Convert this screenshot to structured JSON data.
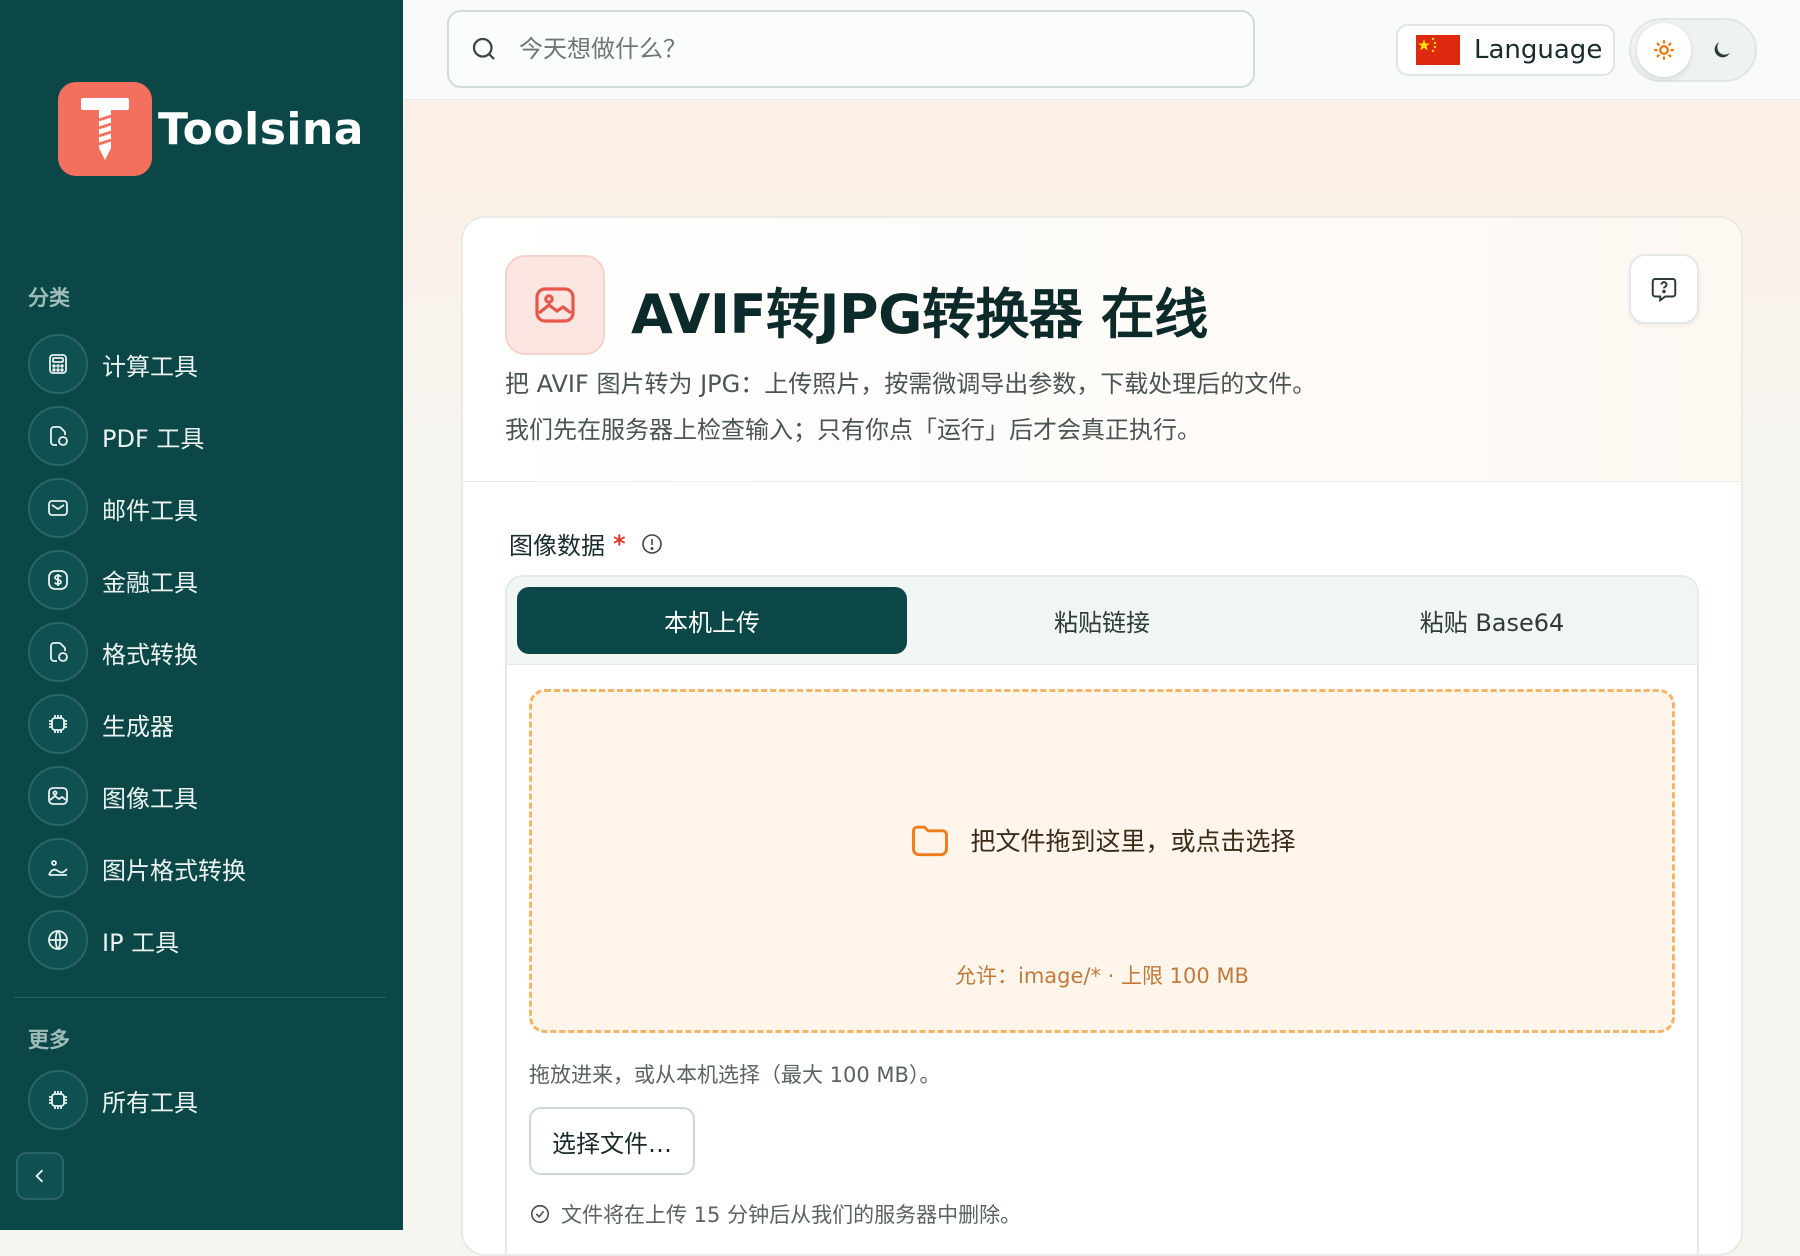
{
  "sidebar": {
    "brand": "Toolsina",
    "category_label": "分类",
    "items": [
      {
        "label": "计算工具",
        "icon": "calculator-icon"
      },
      {
        "label": "PDF 工具",
        "icon": "file-icon"
      },
      {
        "label": "邮件工具",
        "icon": "mail-icon"
      },
      {
        "label": "金融工具",
        "icon": "dollar-icon"
      },
      {
        "label": "格式转换",
        "icon": "file-convert-icon"
      },
      {
        "label": "生成器",
        "icon": "chip-icon"
      },
      {
        "label": "图像工具",
        "icon": "image-icon"
      },
      {
        "label": "图片格式转换",
        "icon": "image-convert-icon"
      },
      {
        "label": "IP 工具",
        "icon": "globe-icon"
      }
    ],
    "more_label": "更多",
    "more_items": [
      {
        "label": "所有工具",
        "icon": "chip-icon"
      }
    ]
  },
  "topbar": {
    "search_placeholder": "今天想做什么？",
    "language_label": "Language"
  },
  "tool": {
    "title": "AVIF转JPG转换器 在线",
    "desc_line1": "把 AVIF 图片转为 JPG：上传照片，按需微调导出参数，下载处理后的文件。",
    "desc_line2": "我们先在服务器上检查输入；只有你点「运行」后才会真正执行。",
    "field_label": "图像数据",
    "required_mark": "*",
    "tabs": [
      "本机上传",
      "粘贴链接",
      "粘贴 Base64"
    ],
    "active_tab": 0,
    "dropzone_text": "把文件拖到这里，或点击选择",
    "dropzone_allow": "允许：image/* · 上限 100 MB",
    "hint": "拖放进来，或从本机选择（最大 100 MB）。",
    "choose_button": "选择文件…",
    "note": "文件将在上传 15 分钟后从我们的服务器中删除。"
  },
  "colors": {
    "sidebar_bg": "#0b4747",
    "accent": "#f2705d",
    "dropzone_border": "#f1b468"
  }
}
